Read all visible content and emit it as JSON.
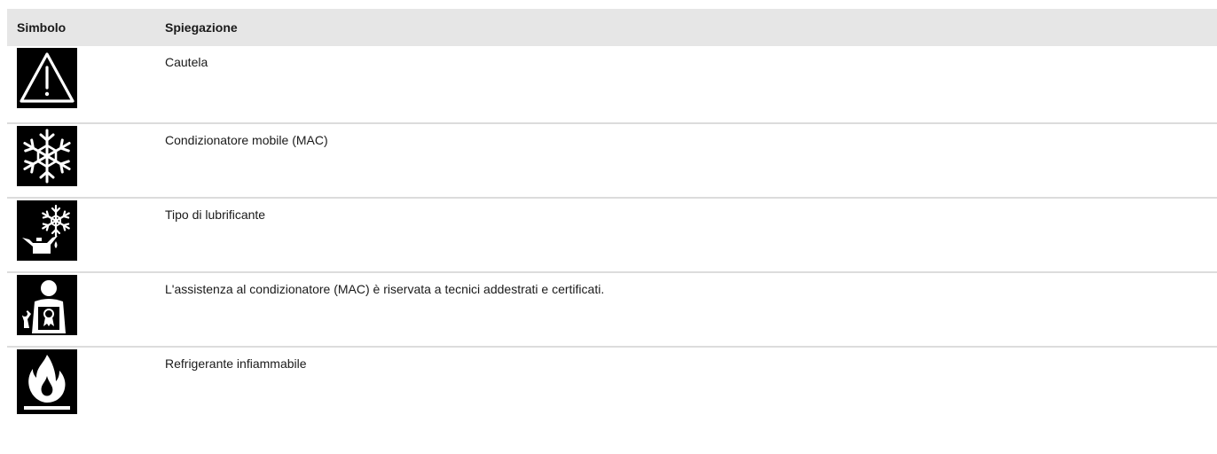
{
  "table": {
    "headers": {
      "symbol": "Simbolo",
      "explanation": "Spiegazione"
    },
    "rows": [
      {
        "icon": "warning-triangle-icon",
        "text": "Cautela"
      },
      {
        "icon": "snowflake-icon",
        "text": "Condizionatore mobile (MAC)"
      },
      {
        "icon": "oil-can-snowflake-icon",
        "text": "Tipo di lubrificante"
      },
      {
        "icon": "certified-technician-icon",
        "text": "L'assistenza al condizionatore (MAC) è riservata a tecnici addestrati e certificati."
      },
      {
        "icon": "flame-icon",
        "text": "Refrigerante infiammabile"
      }
    ]
  }
}
